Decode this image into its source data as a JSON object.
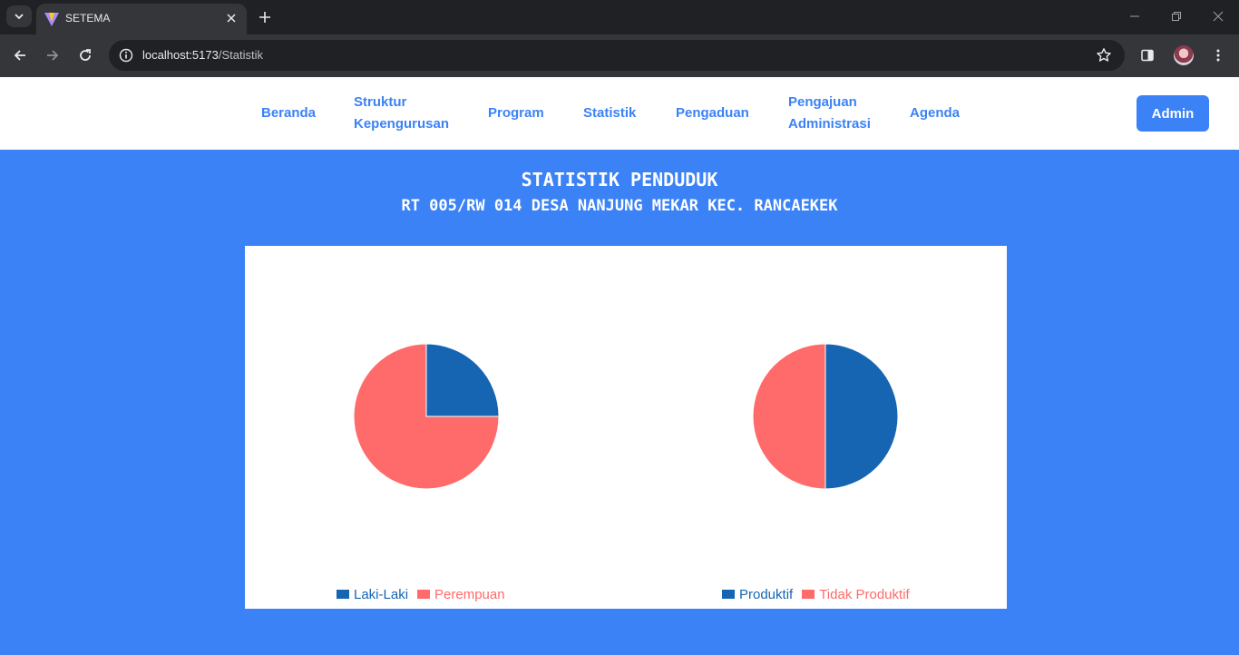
{
  "browser": {
    "tab_title": "SETEMA",
    "url_host": "localhost:5173",
    "url_path": "/Statistik"
  },
  "nav": {
    "items": [
      {
        "label_line1": "Beranda",
        "label_line2": ""
      },
      {
        "label_line1": "Struktur",
        "label_line2": "Kepengurusan"
      },
      {
        "label_line1": "Program",
        "label_line2": ""
      },
      {
        "label_line1": "Statistik",
        "label_line2": ""
      },
      {
        "label_line1": "Pengaduan",
        "label_line2": ""
      },
      {
        "label_line1": "Pengajuan",
        "label_line2": "Administrasi"
      },
      {
        "label_line1": "Agenda",
        "label_line2": ""
      }
    ],
    "admin_label": "Admin"
  },
  "page": {
    "title": "STATISTIK PENDUDUK",
    "subtitle": "RT 005/RW 014 DESA NANJUNG MEKAR KEC. RANCAEKEK"
  },
  "colors": {
    "accent": "#3b82f6",
    "series_a": "#1565b3",
    "series_b": "#ff6b6b"
  },
  "chart_data": [
    {
      "type": "pie",
      "title": "",
      "categories": [
        "Laki-Laki",
        "Perempuan"
      ],
      "values": [
        1,
        3
      ],
      "colors": [
        "#1565b3",
        "#ff6b6b"
      ],
      "legend": "bottom"
    },
    {
      "type": "pie",
      "title": "",
      "categories": [
        "Produktif",
        "Tidak Produktif"
      ],
      "values": [
        1,
        1
      ],
      "colors": [
        "#1565b3",
        "#ff6b6b"
      ],
      "legend": "bottom"
    }
  ]
}
